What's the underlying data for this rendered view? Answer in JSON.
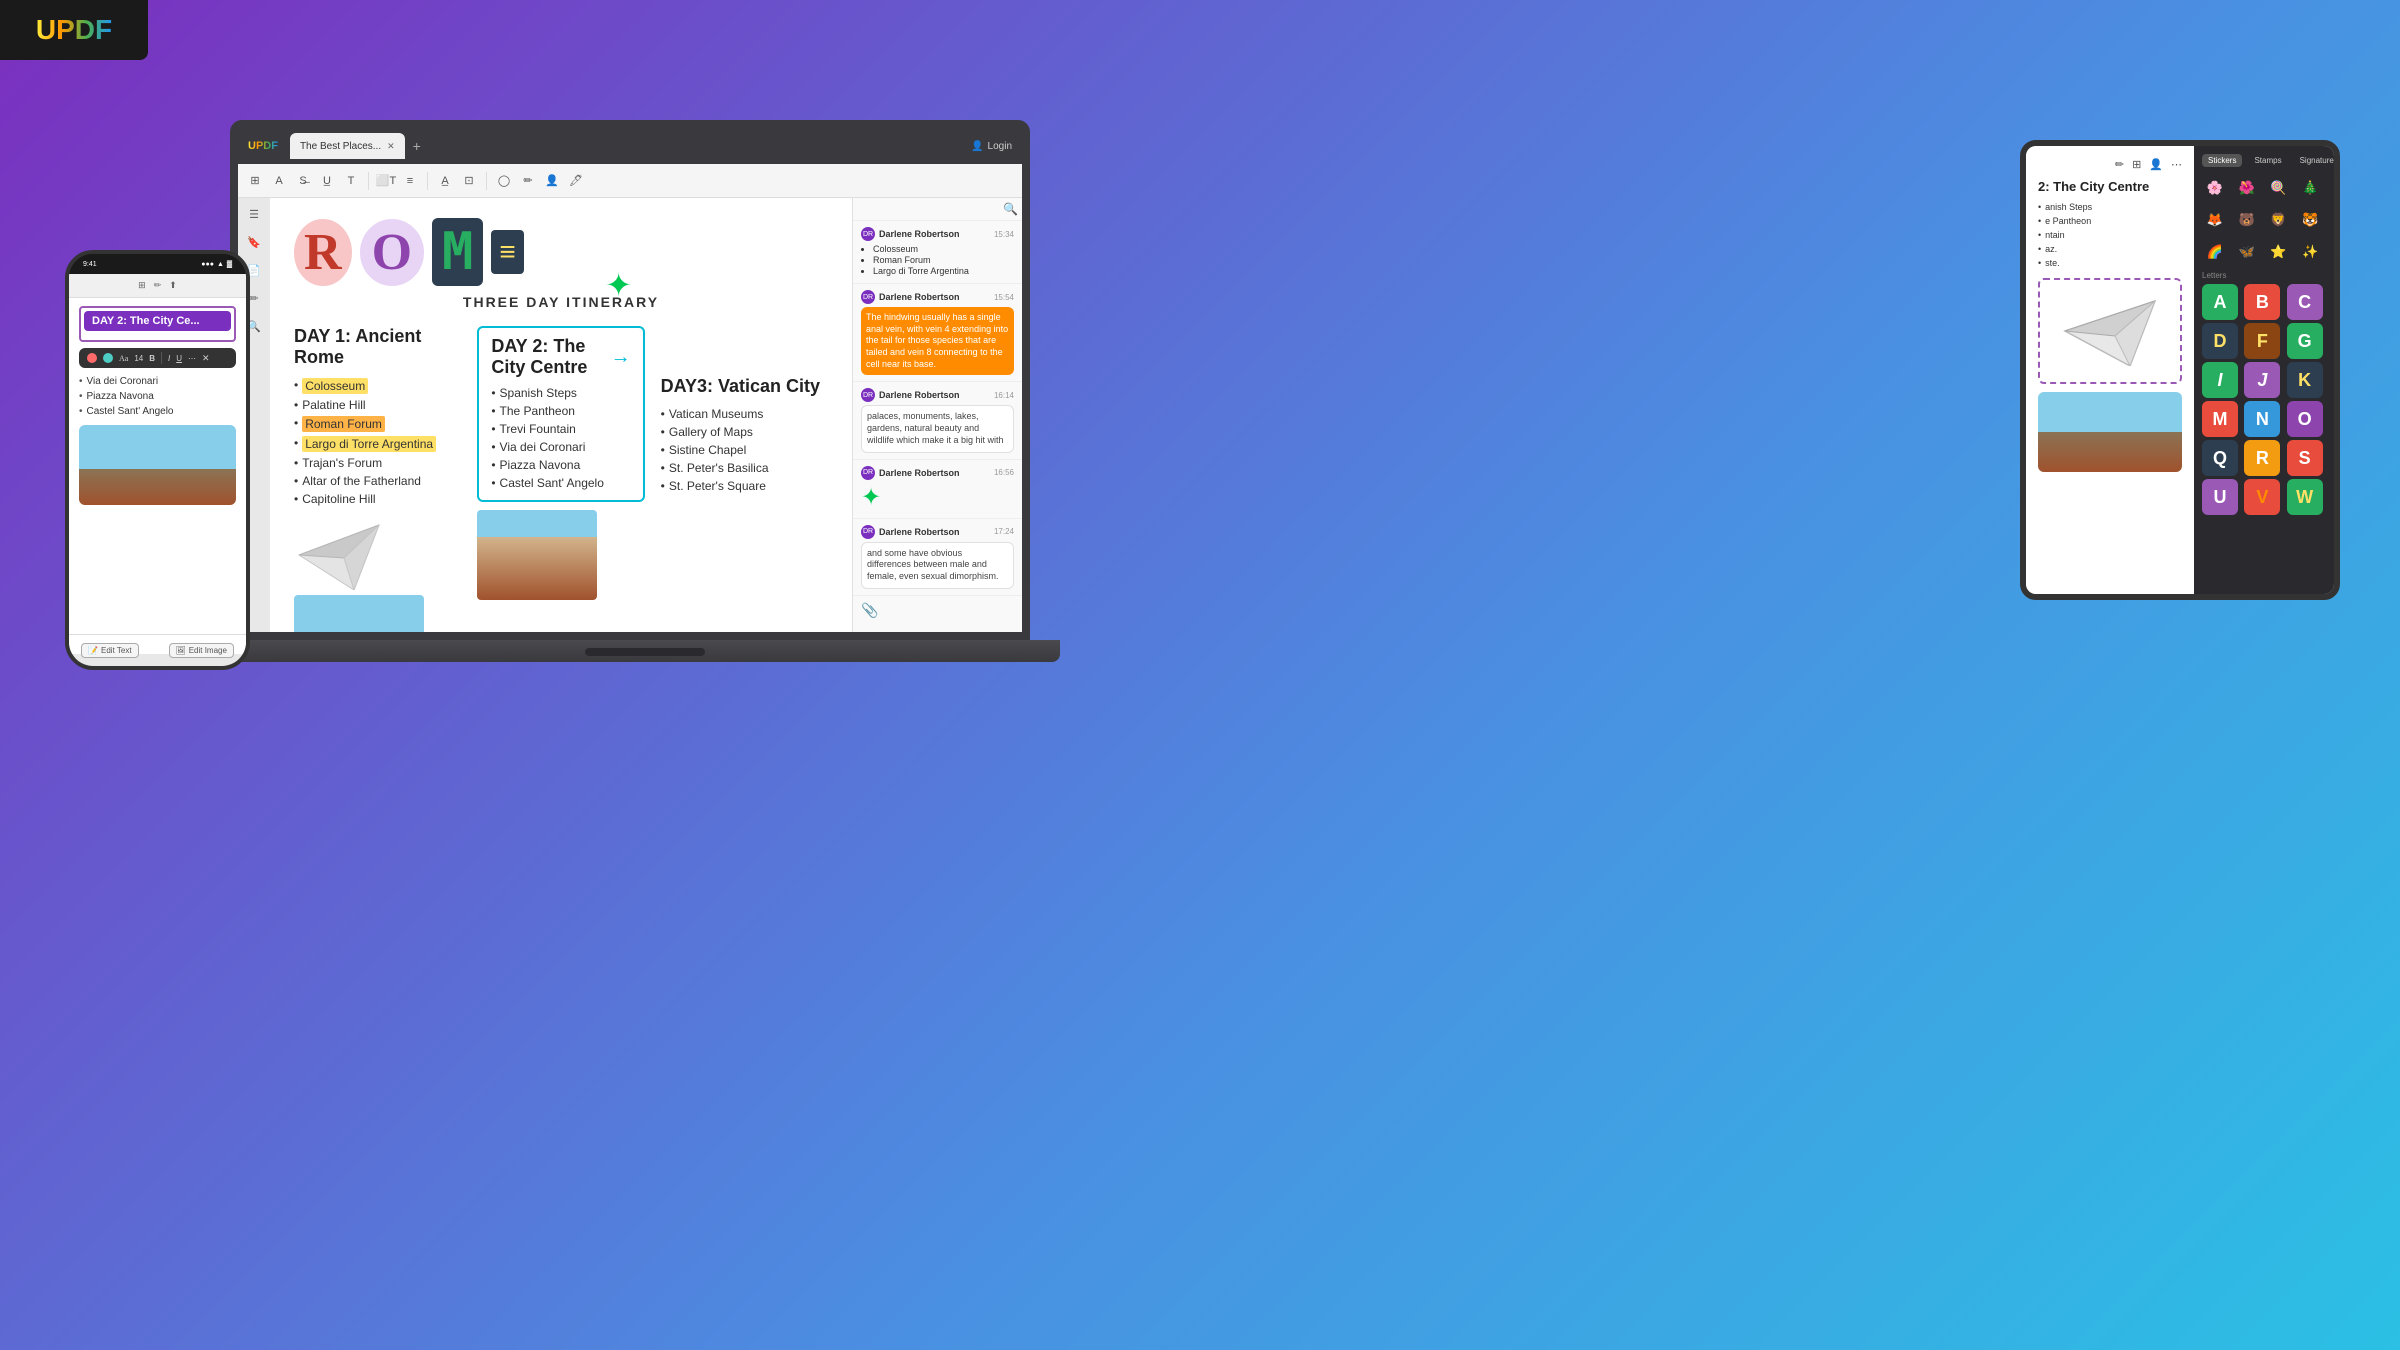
{
  "app": {
    "logo": "UPDF",
    "background": "linear-gradient(135deg, #7B2FBE 0%, #4A90E2 60%, #2BC0E4 100%)"
  },
  "laptop": {
    "tab_title": "The Best Places...",
    "login_label": "Login",
    "toolbar_icons": [
      "format",
      "strikethrough",
      "underline",
      "text",
      "text-box",
      "text-align",
      "highlight",
      "crop",
      "shape",
      "annotate",
      "fill"
    ],
    "document": {
      "title": "ROME",
      "subtitle": "THREE DAY ITINERARY",
      "day1": {
        "heading": "DAY 1: Ancient Rome",
        "items": [
          "Colosseum",
          "Palatine Hill",
          "Roman Forum",
          "Largo di Torre Argentina",
          "Trajan's Forum",
          "Altar of the Fatherland",
          "Capitoline Hill"
        ],
        "highlighted": [
          "Colosseum",
          "Roman Forum",
          "Largo di Torre Argentina"
        ]
      },
      "day2": {
        "heading": "DAY 2: The City Centre",
        "items": [
          "Spanish Steps",
          "The Pantheon",
          "Trevi Fountain",
          "Via dei Coronari",
          "Piazza Navona",
          "Castel Sant' Angelo"
        ]
      },
      "day3": {
        "heading": "DAY3: Vatican City",
        "items": [
          "Vatican Museums",
          "Gallery of Maps",
          "Sistine Chapel",
          "St. Peter's Basilica",
          "St. Peter's Square"
        ]
      }
    },
    "chat": {
      "messages": [
        {
          "sender": "Darlene Robertson",
          "time": "15:34",
          "avatar": "DR",
          "type": "list",
          "content": [
            "Colosseum",
            "Roman Forum",
            "Largo di Torre Argentina"
          ]
        },
        {
          "sender": "Darlene Robertson",
          "time": "15:54",
          "avatar": "DR",
          "type": "orange-bubble",
          "content": "The hindwing usually has a single anal vein, with vein 4 extending into the tail for those species that are tailed and vein 8 connecting to the cell near its base."
        },
        {
          "sender": "Darlene Robertson",
          "time": "16:14",
          "avatar": "DR",
          "type": "bubble",
          "content": "palaces, monuments, lakes, gardens, natural beauty and wildlife which make it a big hit with"
        },
        {
          "sender": "Darlene Robertson",
          "time": "16:56",
          "avatar": "DR",
          "type": "star"
        },
        {
          "sender": "Darlene Robertson",
          "time": "17:24",
          "avatar": "DR",
          "type": "bubble",
          "content": "and some have obvious differences between male and female, even sexual dimorphism."
        }
      ]
    }
  },
  "phone": {
    "time": "9:41",
    "signal": "●●●",
    "battery": "■■■",
    "day2_heading": "DAY 2: The City Ce...",
    "items": [
      "Via dei Coronari",
      "Piazza Navona",
      "Castel Sant' Angelo"
    ],
    "bottom_buttons": [
      "Edit Text",
      "Edit Image"
    ]
  },
  "tablet": {
    "day2_heading": "2: The City Centre",
    "items": [
      "anish Steps",
      "e Pantheon",
      "ntain",
      "az.",
      "ste."
    ],
    "sticker_tabs": [
      "Stickers",
      "Stamps",
      "Signature"
    ],
    "stickers": [
      "🌸",
      "🌺",
      "🍭",
      "🎄",
      "🦊",
      "🐻",
      "🦁",
      "🐯",
      "🌈",
      "🦋",
      "🌟",
      "⭐"
    ],
    "letters_label": "Letters",
    "letter_stickers": [
      {
        "char": "A",
        "bg": "#27AE60",
        "color": "#fff"
      },
      {
        "char": "B",
        "bg": "#E74C3C",
        "color": "#fff"
      },
      {
        "char": "C",
        "bg": "#9B59B6",
        "color": "#fff"
      },
      {
        "char": "D",
        "bg": "#2C3E50",
        "color": "#FFE066"
      },
      {
        "char": "F",
        "bg": "#8B4513",
        "color": "#FFE066"
      },
      {
        "char": "G",
        "bg": "#27AE60",
        "color": "#fff"
      },
      {
        "char": "I",
        "bg": "#27AE60",
        "color": "#fff"
      },
      {
        "char": "J",
        "bg": "#9B59B6",
        "color": "#fff"
      },
      {
        "char": "K",
        "bg": "#2C3E50",
        "color": "#FFE066"
      },
      {
        "char": "M",
        "bg": "#E74C3C",
        "color": "#fff"
      },
      {
        "char": "N",
        "bg": "#3498DB",
        "color": "#fff"
      },
      {
        "char": "O",
        "bg": "#8E44AD",
        "color": "#fff"
      },
      {
        "char": "Q",
        "bg": "#2C3E50",
        "color": "#fff"
      },
      {
        "char": "R",
        "bg": "#F39C12",
        "color": "#fff"
      },
      {
        "char": "S",
        "bg": "#E74C3C",
        "color": "#fff"
      },
      {
        "char": "U",
        "bg": "#9B59B6",
        "color": "#fff"
      },
      {
        "char": "V",
        "bg": "#E74C3C",
        "color": "#FF8C00"
      },
      {
        "char": "W",
        "bg": "#27AE60",
        "color": "#FFE066"
      }
    ]
  }
}
